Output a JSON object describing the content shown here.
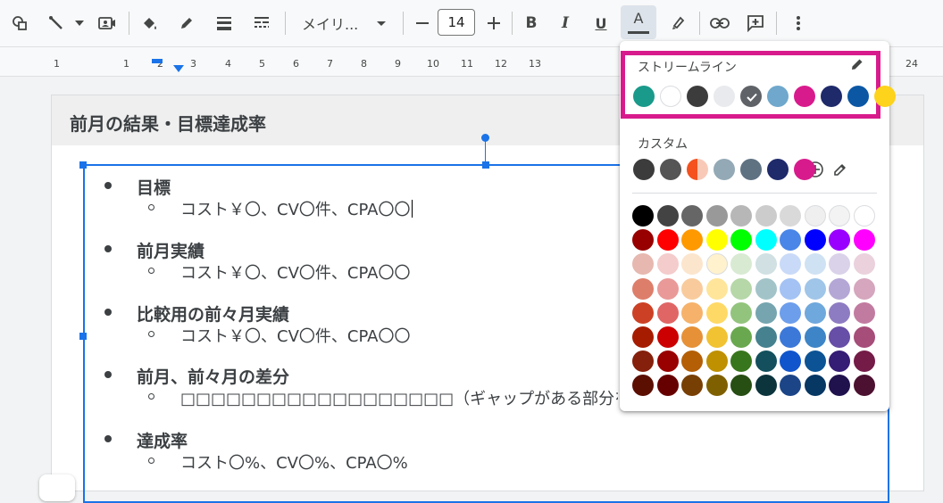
{
  "toolbar": {
    "font_name": "メイリ...",
    "font_size": "14",
    "bold_label": "B",
    "italic_label": "I",
    "underline_label": "U",
    "text_color_label": "A"
  },
  "ruler": {
    "numbers": [
      "1",
      "1",
      "2",
      "3",
      "4",
      "5",
      "6",
      "7",
      "8",
      "9",
      "10",
      "11",
      "12",
      "13",
      "24"
    ]
  },
  "slide": {
    "title": "前月の結果・目標達成率",
    "items": [
      {
        "heading": "目標",
        "sub": "コスト￥〇、CV〇件、CPA〇〇"
      },
      {
        "heading": "前月実績",
        "sub": "コスト￥〇、CV〇件、CPA〇〇"
      },
      {
        "heading": "比較用の前々月実績",
        "sub": "コスト￥〇、CV〇件、CPA〇〇"
      },
      {
        "heading": "前月、前々月の差分",
        "sub": "□□□□□□□□□□□□□□□□□□（ギャップがある部分を"
      },
      {
        "heading": "達成率",
        "sub": "コスト〇%、CV〇%、CPA〇%"
      }
    ]
  },
  "palette": {
    "theme_label": "ストリームライン",
    "custom_label": "カスタム",
    "theme_colors": [
      "#1a9a8a",
      "#ffffff",
      "#3c3c3c",
      "#e8eaed",
      "#3c3c3c",
      "#6fa8cc",
      "#d81b8c",
      "#1f2a6b",
      "#0b57a4",
      "#fdd31b"
    ],
    "selected_index": 4,
    "custom_colors": [
      "#3c3c3c",
      "#555555",
      "#f4511e",
      "#93a9b5",
      "#5f7282",
      "#1f2a6b",
      "#d81b8c"
    ],
    "grid": [
      [
        "#000000",
        "#434343",
        "#666666",
        "#999999",
        "#b7b7b7",
        "#cccccc",
        "#d9d9d9",
        "#efefef",
        "#f3f3f3",
        "#ffffff"
      ],
      [
        "#980000",
        "#ff0000",
        "#ff9900",
        "#ffff00",
        "#00ff00",
        "#00ffff",
        "#4a86e8",
        "#0000ff",
        "#9900ff",
        "#ff00ff"
      ],
      [
        "#e6b8af",
        "#f4cccc",
        "#fce5cd",
        "#fff2cc",
        "#d9ead3",
        "#d0e0e3",
        "#c9daf8",
        "#cfe2f3",
        "#d9d2e9",
        "#ead1dc"
      ],
      [
        "#dd7e6b",
        "#ea9999",
        "#f9cb9c",
        "#ffe599",
        "#b6d7a8",
        "#a2c4c9",
        "#a4c2f4",
        "#9fc5e8",
        "#b4a7d6",
        "#d5a6bd"
      ],
      [
        "#cc4125",
        "#e06666",
        "#f6b26b",
        "#ffd966",
        "#93c47d",
        "#76a5af",
        "#6d9eeb",
        "#6fa8dc",
        "#8e7cc3",
        "#c27ba0"
      ],
      [
        "#a61c00",
        "#cc0000",
        "#e69138",
        "#f1c232",
        "#6aa84f",
        "#45818e",
        "#3c78d8",
        "#3d85c6",
        "#674ea7",
        "#a64d79"
      ],
      [
        "#85200c",
        "#990000",
        "#b45f06",
        "#bf9000",
        "#38761d",
        "#134f5c",
        "#1155cc",
        "#0b5394",
        "#351c75",
        "#741b47"
      ],
      [
        "#5b0f00",
        "#660000",
        "#783f04",
        "#7f6000",
        "#274e13",
        "#0c343d",
        "#1c4587",
        "#073763",
        "#20124d",
        "#4c1130"
      ]
    ]
  }
}
